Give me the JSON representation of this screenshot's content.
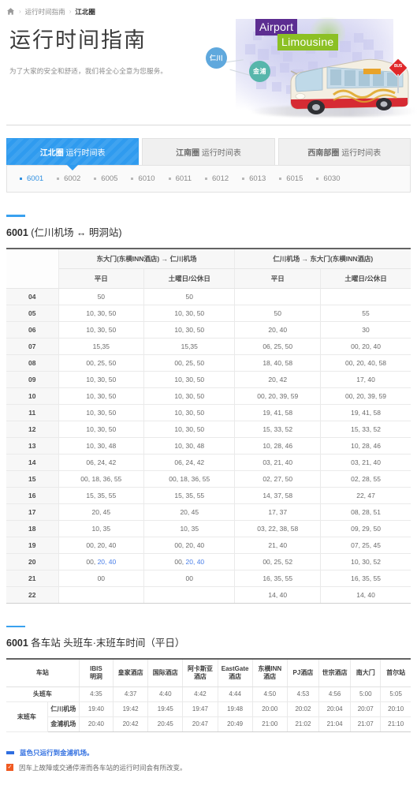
{
  "breadcrumb": {
    "home_icon": "home-icon",
    "separator": "›",
    "items": [
      "运行时间指南",
      "江北圈"
    ]
  },
  "hero": {
    "title": "运行时间指南",
    "subtitle": "为了大家的安全和舒适，我们将全心全意为您服务。",
    "badge_airport": "Airport",
    "badge_limousine": "Limousine",
    "map_label_incheon": "仁川",
    "map_label_gimpo": "金浦",
    "bus_stop_sign": "BUS",
    "colors": {
      "airport_badge": "#5c2d91",
      "limousine_badge": "#8cc024",
      "incheon_circle": "#5fa8dd",
      "gimpo_circle": "#57b6ab",
      "stop_sign": "#e02729"
    }
  },
  "tabs": [
    {
      "strong": "江北圈",
      "rest": " 运行时间表",
      "active": true
    },
    {
      "strong": "江南圈",
      "rest": " 运行时间表",
      "active": false
    },
    {
      "strong": "西南部圈",
      "rest": " 运行时间表",
      "active": false
    }
  ],
  "routes": [
    {
      "label": "6001",
      "active": true
    },
    {
      "label": "6002",
      "active": false
    },
    {
      "label": "6005",
      "active": false
    },
    {
      "label": "6010",
      "active": false
    },
    {
      "label": "6011",
      "active": false
    },
    {
      "label": "6012",
      "active": false
    },
    {
      "label": "6013",
      "active": false
    },
    {
      "label": "6015",
      "active": false
    },
    {
      "label": "6030",
      "active": false
    }
  ],
  "timetable_section": {
    "title_number": "6001",
    "title_rest": " (仁川机场 ↔ 明洞站)",
    "group_headers": [
      "东大门(东横INN酒店) → 仁川机场",
      "仁川机场 → 东大门(东横INN酒店)"
    ],
    "sub_headers": [
      "平日",
      "土曜日/公休日",
      "平日",
      "土曜日/公休日"
    ],
    "rows": [
      {
        "hour": "04",
        "cells": [
          "50",
          "50",
          "",
          ""
        ],
        "blue": []
      },
      {
        "hour": "05",
        "cells": [
          "10, 30, 50",
          "10, 30, 50",
          "50",
          "55"
        ],
        "blue": []
      },
      {
        "hour": "06",
        "cells": [
          "10, 30, 50",
          "10, 30, 50",
          "20, 40",
          "30"
        ],
        "blue": []
      },
      {
        "hour": "07",
        "cells": [
          "15,35",
          "15,35",
          "06, 25, 50",
          "00, 20, 40"
        ],
        "blue": []
      },
      {
        "hour": "08",
        "cells": [
          "00, 25, 50",
          "00, 25, 50",
          "18, 40, 58",
          "00, 20, 40, 58"
        ],
        "blue": []
      },
      {
        "hour": "09",
        "cells": [
          "10, 30, 50",
          "10, 30, 50",
          "20, 42",
          "17, 40"
        ],
        "blue": []
      },
      {
        "hour": "10",
        "cells": [
          "10, 30, 50",
          "10, 30, 50",
          "00, 20, 39, 59",
          "00, 20, 39, 59"
        ],
        "blue": []
      },
      {
        "hour": "11",
        "cells": [
          "10, 30, 50",
          "10, 30, 50",
          "19, 41, 58",
          "19, 41, 58"
        ],
        "blue": []
      },
      {
        "hour": "12",
        "cells": [
          "10, 30, 50",
          "10, 30, 50",
          "15, 33, 52",
          "15, 33, 52"
        ],
        "blue": []
      },
      {
        "hour": "13",
        "cells": [
          "10, 30, 48",
          "10, 30, 48",
          "10, 28, 46",
          "10, 28, 46"
        ],
        "blue": []
      },
      {
        "hour": "14",
        "cells": [
          "06, 24, 42",
          "06, 24, 42",
          "03, 21, 40",
          "03, 21, 40"
        ],
        "blue": []
      },
      {
        "hour": "15",
        "cells": [
          "00, 18, 36, 55",
          "00, 18, 36, 55",
          "02, 27, 50",
          "02, 28, 55"
        ],
        "blue": []
      },
      {
        "hour": "16",
        "cells": [
          "15, 35, 55",
          "15, 35, 55",
          "14, 37, 58",
          "22, 47"
        ],
        "blue": []
      },
      {
        "hour": "17",
        "cells": [
          "20, 45",
          "20, 45",
          "17, 37",
          "08, 28, 51"
        ],
        "blue": []
      },
      {
        "hour": "18",
        "cells": [
          "10, 35",
          "10, 35",
          "03, 22, 38, 58",
          "09, 29, 50"
        ],
        "blue": []
      },
      {
        "hour": "19",
        "cells": [
          "00, 20, 40",
          "00, 20, 40",
          "21, 40",
          "07, 25, 45"
        ],
        "blue": []
      },
      {
        "hour": "20",
        "cells": [
          "00, 20, 40",
          "00, 20, 40",
          "00, 25, 52",
          "10, 30, 52"
        ],
        "blue": [
          0,
          1
        ],
        "blue_prefix": "00, ",
        "blue_part": "20, 40"
      },
      {
        "hour": "21",
        "cells": [
          "00",
          "00",
          "16, 35, 55",
          "16, 35, 55"
        ],
        "blue": [
          0,
          1
        ]
      },
      {
        "hour": "22",
        "cells": [
          "",
          "",
          "14, 40",
          "14, 40"
        ],
        "blue": []
      }
    ]
  },
  "firstlast_section": {
    "title_number": "6001",
    "title_rest": " 各车站 头班车·末班车时间（平日）",
    "station_col_label": "车站",
    "stations": [
      "IBIS\n明洞",
      "皇家酒店",
      "国际酒店",
      "阿卡斯亚\n酒店",
      "EastGate\n酒店",
      "东横INN\n酒店",
      "PJ酒店",
      "世宗酒店",
      "南大门",
      "首尔站"
    ],
    "first_label": "头班车",
    "first_times": [
      "4:35",
      "4:37",
      "4:40",
      "4:42",
      "4:44",
      "4:50",
      "4:53",
      "4:56",
      "5:00",
      "5:05"
    ],
    "last_label": "末班车",
    "last_rows": [
      {
        "label": "仁川机场",
        "color": "red",
        "times": [
          "19:40",
          "19:42",
          "19:45",
          "19:47",
          "19:48",
          "20:00",
          "20:02",
          "20:04",
          "20:07",
          "20:10"
        ]
      },
      {
        "label": "金浦机场",
        "color": "navy",
        "times": [
          "20:40",
          "20:42",
          "20:45",
          "20:47",
          "20:49",
          "21:00",
          "21:02",
          "21:04",
          "21:07",
          "21:10"
        ]
      }
    ]
  },
  "notes": [
    {
      "marker": "blue-bar-icon",
      "text": "蓝色只运行到金浦机场。",
      "style": "blue"
    },
    {
      "marker": "orange-check-icon",
      "text": "因车上故障或交通停滞而各车站的运行时间会有所改变。",
      "style": "gray"
    }
  ]
}
